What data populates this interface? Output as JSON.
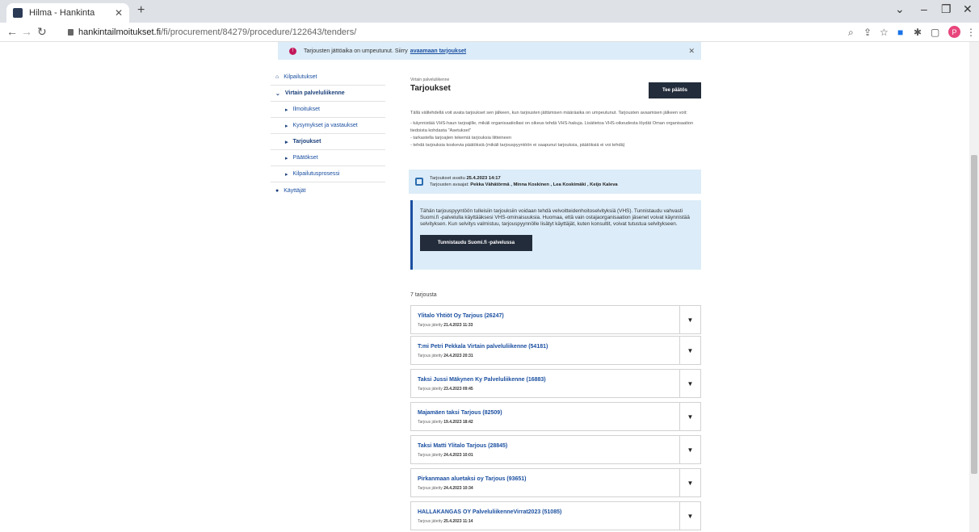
{
  "browser": {
    "tab_title": "Hilma - Hankinta",
    "tab_close": "✕",
    "new_tab": "+",
    "url_host": "hankintailmoitukset.fi",
    "url_path": "/fi/procurement/84279/procedure/122643/tenders/",
    "profile_initial": "P"
  },
  "alert": {
    "text": "Tarjousten jättöaika on umpeutunut. Siirry",
    "link": "avaamaan tarjoukset",
    "close": "✕"
  },
  "sidebar": {
    "items": [
      {
        "label": "Kilpailutukset",
        "icon": "home-icon"
      },
      {
        "label": "Virtain palveluliikenne",
        "icon": "chevron-down-icon"
      },
      {
        "label": "Ilmoitukset"
      },
      {
        "label": "Kysymykset ja vastaukset"
      },
      {
        "label": "Tarjoukset"
      },
      {
        "label": "Päätökset"
      },
      {
        "label": "Kilpailutusprosessi"
      },
      {
        "label": "Käyttäjät",
        "icon": "user-icon"
      }
    ]
  },
  "main": {
    "breadcrumb": "Virtain palveluliikenne",
    "title": "Tarjoukset",
    "decide_button": "Tee päätös",
    "intro_para": "Tällä välilehdellä voit avata tarjoukset sen jälkeen, kun tarjousten jättämisen määräaika on umpeutunut. Tarjousten avaamisen jälkeen voit:",
    "intro_list": [
      "- käynnistää VHS-haun tarjoajille, mikäli organisaatiollasi on oikeus tehdä VHS-hakuja. Lisätietoa VHS-oikeudesta löydät Oman organisaation tiedoista kohdasta \"Asetukset\"",
      "- tarkastella tarjoajien tekemiä tarjouksia liitteineen",
      "- tehdä tarjouksia koskevia päätöksiä (mikäli tarjouspyyntöön ei saapunut tarjouksia, päätöksiä ei voi tehdä)"
    ],
    "opened_label": "Tarjoukset avattu",
    "opened_date": "25.4.2023 14:17",
    "openers_label": "Tarjousten avaajat:",
    "openers": "Pekka Vähätörmä , Minna Koskinen , Lea Koskimäki , Keijo Kaleva",
    "vhs_text": "Tähän tarjouspyyntöön tulleisiin tarjouksiin voidaan tehdä velvoitteidenhoitoselvityksiä (VHS). Tunnistaudu vahvasti Suomi.fi -palvelulla käyttääksesi VHS-ominaisuuksia. Huomaa, että vain ostajaorganisaation jäsenet voivat käynnistää selvityksen. Kun selvitys valmistuu, tarjouspyynnölle lisätyt käyttäjät, kuten konsultit, voivat tutustua selvitykseen.",
    "vhs_button": "Tunnistaudu Suomi.fi -palvelussa",
    "offer_count": "7 tarjousta",
    "date_label": "Tarjous jätetty",
    "offers": [
      {
        "name": "Ylitalo Yhtiöt Oy Tarjous (26247)",
        "date": "21.4.2023 11:33"
      },
      {
        "name": "T:mi Petri Pekkala Virtain palveluliikenne (54181)",
        "date": "24.4.2023 20:31"
      },
      {
        "name": "Taksi Jussi Mäkynen Ky Palveluliikenne (16883)",
        "date": "23.4.2023 09:45"
      },
      {
        "name": "Majamäen taksi Tarjous (82509)",
        "date": "19.4.2023 18:42"
      },
      {
        "name": "Taksi Matti Ylitalo Tarjous (28845)",
        "date": "24.4.2023 10:01"
      },
      {
        "name": "Pirkanmaan aluetaksi oy Tarjous (93651)",
        "date": "24.4.2023 10:34"
      },
      {
        "name": "HALLAKANGAS OY PalveluliikenneVirrat2023 (51085)",
        "date": "25.4.2023 11:14"
      }
    ]
  }
}
